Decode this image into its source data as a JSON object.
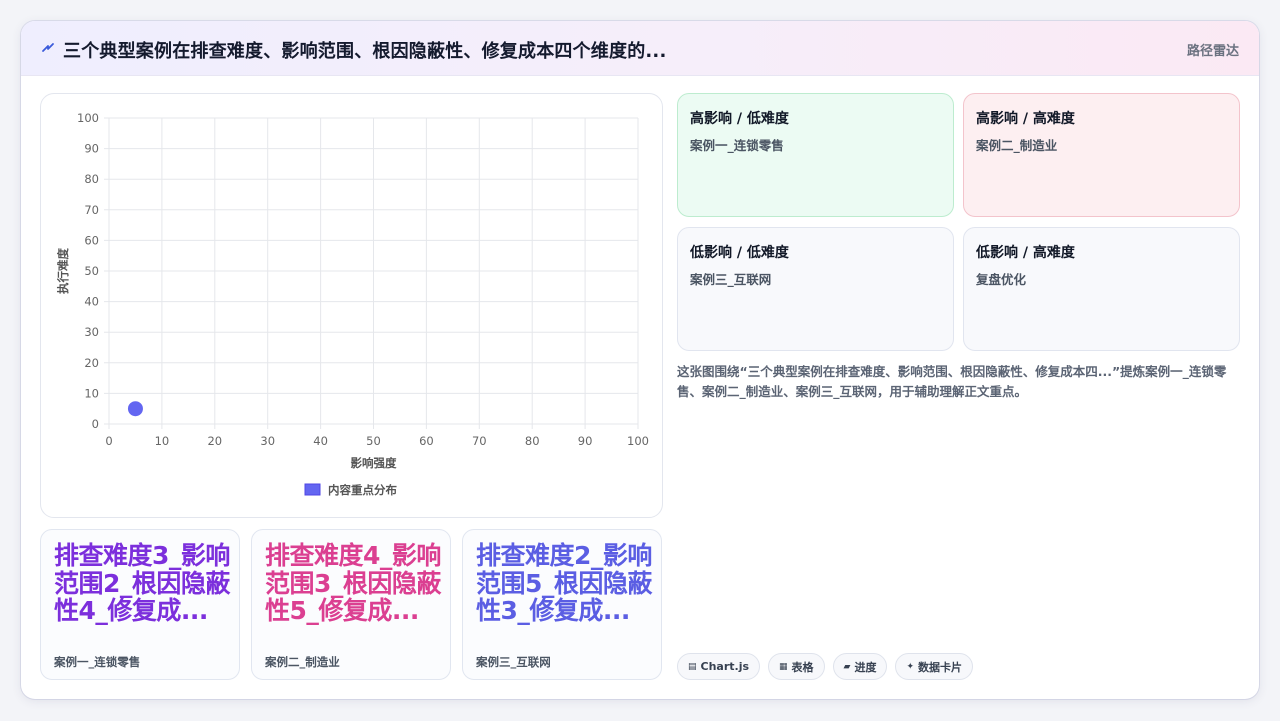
{
  "header": {
    "title": "三个典型案例在排查难度、影响范围、根因隐蔽性、修复成本四个维度的...",
    "tag": "路径雷达",
    "icon": "lightning-icon"
  },
  "chart_data": {
    "type": "scatter",
    "xlabel": "影响强度",
    "ylabel": "执行难度",
    "xlim": [
      0,
      100
    ],
    "ylim": [
      0,
      100
    ],
    "xticks": [
      "0",
      "10",
      "20",
      "30",
      "40",
      "50",
      "60",
      "70",
      "80",
      "90",
      "100"
    ],
    "yticks": [
      "0",
      "10",
      "20",
      "30",
      "40",
      "50",
      "60",
      "70",
      "80",
      "90",
      "100"
    ],
    "grid": true,
    "legend_position": "bottom",
    "series": [
      {
        "name": "内容重点分布",
        "color": "#6366f1",
        "points": [
          {
            "x": 5,
            "y": 5
          }
        ]
      }
    ]
  },
  "quadrants": [
    {
      "title": "高影响 / 低难度",
      "item": "案例一_连锁零售"
    },
    {
      "title": "高影响 / 高难度",
      "item": "案例二_制造业"
    },
    {
      "title": "低影响 / 低难度",
      "item": "案例三_互联网"
    },
    {
      "title": "低影响 / 高难度",
      "item": "复盘优化"
    }
  ],
  "description": "这张图围绕“三个典型案例在排查难度、影响范围、根因隐蔽性、修复成本四...”提炼案例一_连锁零售、案例二_制造业、案例三_互联网，用于辅助理解正文重点。",
  "stats": [
    {
      "big": "排查难度3_影响范围2_根因隐蔽性4_修复成...",
      "small": "案例一_连锁零售",
      "color": "#7c2fdc"
    },
    {
      "big": "排查难度4_影响范围3_根因隐蔽性5_修复成...",
      "small": "案例二_制造业",
      "color": "#db3f91"
    },
    {
      "big": "排查难度2_影响范围5_根因隐蔽性3_修复成...",
      "small": "案例三_互联网",
      "color": "#5b5ee3"
    }
  ],
  "chips": [
    {
      "icon": "chart-icon",
      "glyph": "▤",
      "label": "Chart.js"
    },
    {
      "icon": "table-icon",
      "glyph": "▦",
      "label": "表格"
    },
    {
      "icon": "progress-icon",
      "glyph": "▰",
      "label": "进度"
    },
    {
      "icon": "sparkle-icon",
      "glyph": "✦",
      "label": "数据卡片"
    }
  ]
}
